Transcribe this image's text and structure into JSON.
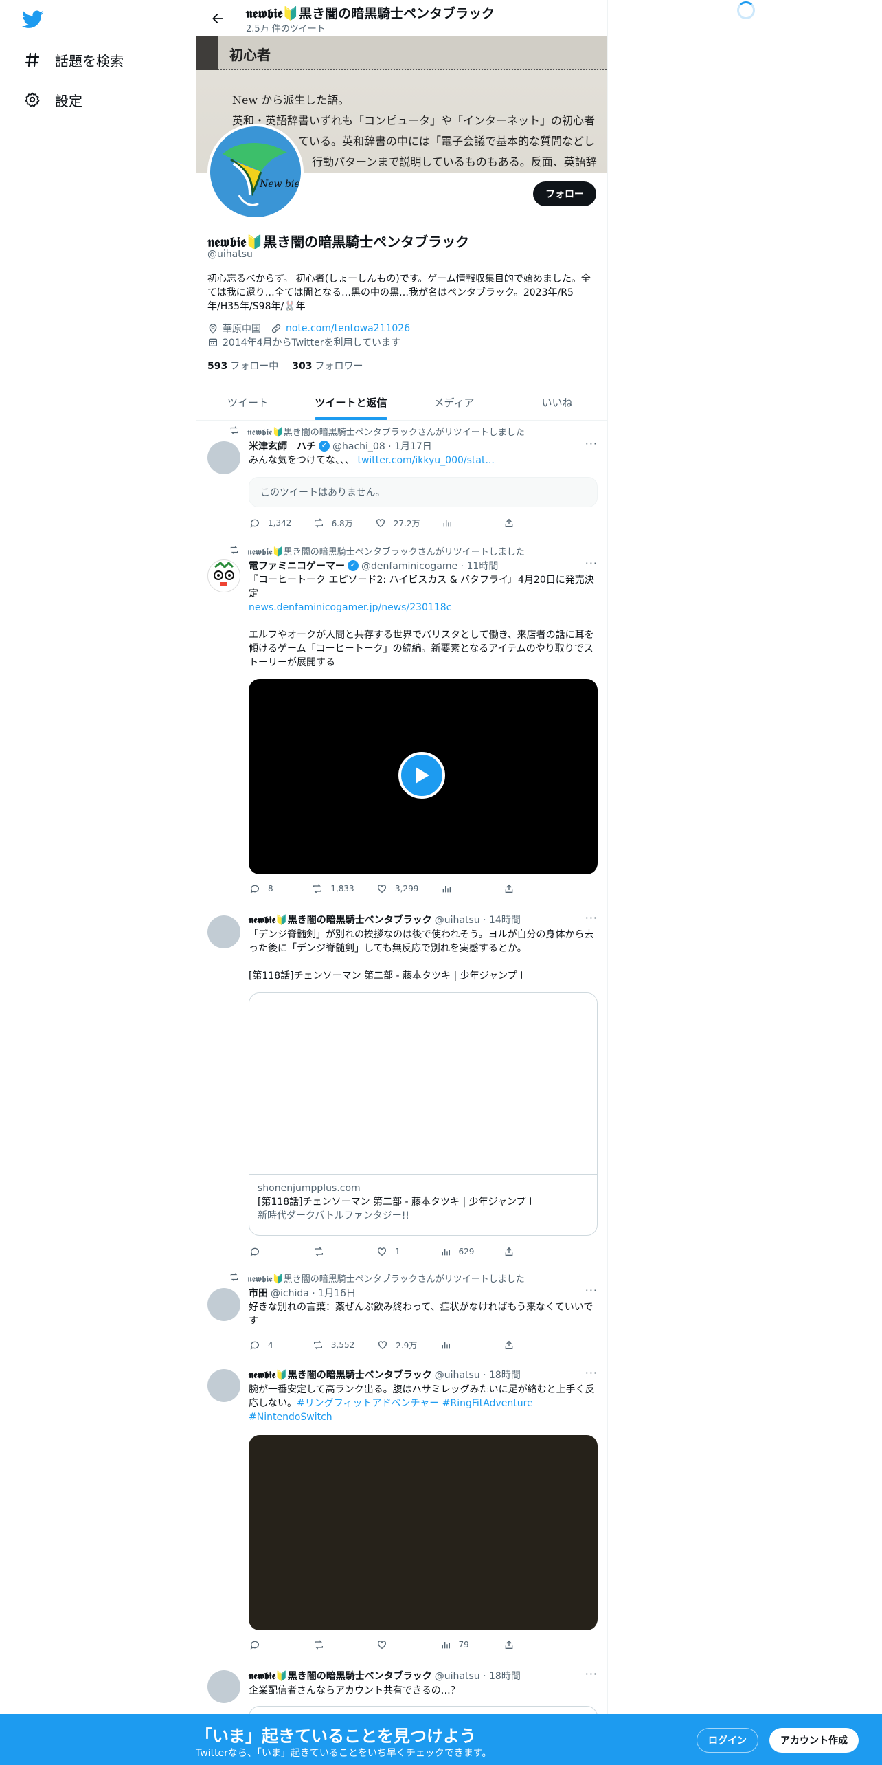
{
  "nav": {
    "explore_label": "話題を検索",
    "settings_label": "設定"
  },
  "header": {
    "name": "𝖓𝖊𝖜𝖇𝖎𝖊🔰黒き闇の暗黒騎士ペンタブラック",
    "tweet_count": "2.5万 件のツイート"
  },
  "banner": {
    "heading": "初心者",
    "line1": "New から派生した語。",
    "line2": "英和・英語辞書いずれも「コンピュータ」や「インターネット」の初心者",
    "line3": "ている。英和辞書の中には「電子会議で基本的な質問などし",
    "line4": "行動パターンまで説明しているものもある。反面、英語辞"
  },
  "avatar_text": "New bie",
  "profile": {
    "follow_label": "フォロー",
    "name": "𝖓𝖊𝖜𝖇𝖎𝖊🔰黒き闇の暗黒騎士ペンタブラック",
    "handle": "@uihatsu",
    "bio": "初心忘るべからず。 初心者(しょーしんもの)です。ゲーム情報収集目的で始めました。全ては我に還り…全ては闇となる…黒の中の黒…我が名はペンタブラック。2023年/R5年/H35年/S98年/🐰年",
    "location": "華原中国",
    "link": "note.com/tentowa211026",
    "joined": "2014年4月からTwitterを利用しています",
    "following_count": "593",
    "following_label": "フォロー中",
    "followers_count": "303",
    "followers_label": "フォロワー"
  },
  "tabs": [
    "ツイート",
    "ツイートと返信",
    "メディア",
    "いいね"
  ],
  "tweets": [
    {
      "retweet_by": "𝖓𝖊𝖜𝖇𝖎𝖊🔰黒き闇の暗黒騎士ペンタブラックさんがリツイートしました",
      "name": "米津玄師　ハチ",
      "handle_time": "@hachi_08 · 1月17日",
      "text": "みんな気をつけてな、、、",
      "link": "twitter.com/ikkyu_000/stat...",
      "unavailable": "このツイートはありません。",
      "replies": "1,342",
      "retweets": "6.8万",
      "likes": "27.2万",
      "views": ""
    },
    {
      "retweet_by": "𝖓𝖊𝖜𝖇𝖎𝖊🔰黒き闇の暗黒騎士ペンタブラックさんがリツイートしました",
      "name": "電ファミニコゲーマー",
      "handle_time": "@denfaminicogame · 11時間",
      "text": "『コーヒートーク エピソード2: ハイビスカス & バタフライ』4月20日に発売決定",
      "link": "news.denfaminicogamer.jp/news/230118c",
      "text2": "エルフやオークが人間と共存する世界でバリスタとして働き、来店者の話に耳を傾けるゲーム「コーヒートーク」の続編。新要素となるアイテムのやり取りでストーリーが展開する",
      "replies": "8",
      "retweets": "1,833",
      "likes": "3,299",
      "views": ""
    },
    {
      "name": "𝖓𝖊𝖜𝖇𝖎𝖊🔰黒き闇の暗黒騎士ペンタブラック",
      "handle_time": "@uihatsu · 14時間",
      "text": "「デンジ脊髄剣」が別れの挨拶なのは後で使われそう。ヨルが自分の身体から去った後に「デンジ脊髄剣」しても無反応で別れを実感するとか。",
      "text2": "[第118話]チェンソーマン 第二部 - 藤本タツキ | 少年ジャンプ＋",
      "card_domain": "shonenjumpplus.com",
      "card_title": "[第118話]チェンソーマン 第二部 - 藤本タツキ | 少年ジャンプ＋",
      "card_desc": "新時代ダークバトルファンタジー!!",
      "replies": "",
      "retweets": "",
      "likes": "1",
      "views": "629"
    },
    {
      "retweet_by": "𝖓𝖊𝖜𝖇𝖎𝖊🔰黒き闇の暗黒騎士ペンタブラックさんがリツイートしました",
      "name": "市田",
      "handle_time": "@ichida · 1月16日",
      "text": "好きな別れの言葉：薬ぜんぶ飲み終わって、症状がなければもう来なくていいです",
      "replies": "4",
      "retweets": "3,552",
      "likes": "2.9万",
      "views": ""
    },
    {
      "name": "𝖓𝖊𝖜𝖇𝖎𝖊🔰黒き闇の暗黒騎士ペンタブラック",
      "handle_time": "@uihatsu · 18時間",
      "text": "腕が一番安定して高ランク出る。腹はハサミレッグみたいに足が絡むと上手く反応しない。",
      "hashtags": "#リングフィットアドベンチャー #RingFitAdventure",
      "hashtag2": "#NintendoSwitch",
      "replies": "",
      "retweets": "",
      "likes": "",
      "views": "79"
    },
    {
      "name": "𝖓𝖊𝖜𝖇𝖎𝖊🔰黒き闇の暗黒騎士ペンタブラック",
      "handle_time": "@uihatsu · 18時間",
      "text": "企業配信者さんならアカウント共有できるの…？"
    }
  ],
  "bottom_bar": {
    "title": "「いま」起きていることを見つけよう",
    "subtitle": "Twitterなら、「いま」起きていることをいち早くチェックできます。",
    "login": "ログイン",
    "signup": "アカウント作成"
  },
  "colors": {
    "accent": "#1d9bf0",
    "text": "#0f1419",
    "muted": "#536471"
  }
}
